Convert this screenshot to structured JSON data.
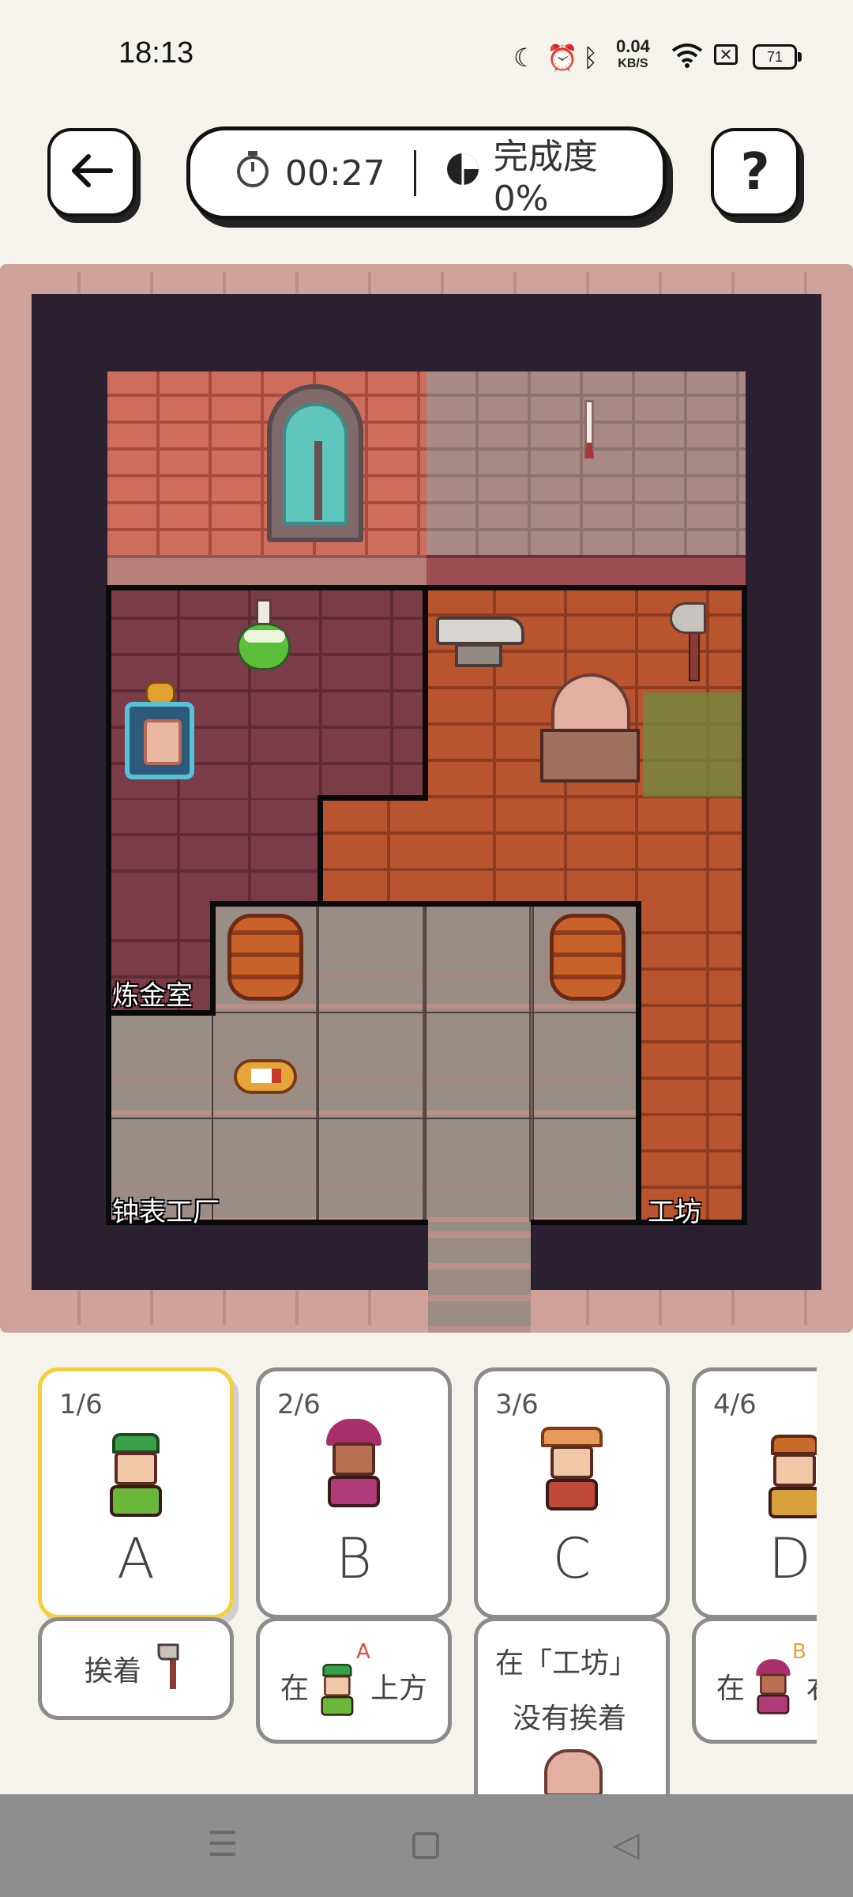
{
  "status_bar": {
    "time": "18:13",
    "net_speed_value": "0.04",
    "net_speed_unit": "KB/S",
    "battery": "71",
    "icons": [
      "moon-icon",
      "alarm-icon",
      "bluetooth-icon",
      "wifi-icon",
      "nfc-icon"
    ]
  },
  "header": {
    "back_icon": "arrow-left-icon",
    "timer": "00:27",
    "progress": "完成度 0%",
    "help_label": "?"
  },
  "board": {
    "rooms": [
      {
        "id": "alchemy",
        "label": "炼金室"
      },
      {
        "id": "clock_factory",
        "label": "钟表工厂"
      },
      {
        "id": "workshop",
        "label": "工坊"
      }
    ],
    "items": [
      "potion",
      "lantern",
      "anvil",
      "axe",
      "dome-machine",
      "barrel",
      "barrel",
      "ticket"
    ]
  },
  "cards": [
    {
      "num": "1/6",
      "letter": "A",
      "selected": true,
      "clue": {
        "text": "挨着",
        "icon": "axe-icon"
      }
    },
    {
      "num": "2/6",
      "letter": "B",
      "selected": false,
      "clue": {
        "prefix": "在",
        "ref": "A",
        "suffix": "上方"
      }
    },
    {
      "num": "3/6",
      "letter": "C",
      "selected": false,
      "clue": {
        "line1": "在「工坊」",
        "line2": "没有挨着"
      }
    },
    {
      "num": "4/6",
      "letter": "D",
      "selected": false,
      "clue": {
        "prefix": "在",
        "ref": "B",
        "suffix": "右"
      }
    }
  ],
  "colors": {
    "accent_selected": "#f5cf3a",
    "ref_letter": "#e04a3a",
    "ref_letter_b": "#e8a23a"
  },
  "navbar": {
    "icons": [
      "menu-icon",
      "home-icon",
      "back-icon"
    ]
  }
}
